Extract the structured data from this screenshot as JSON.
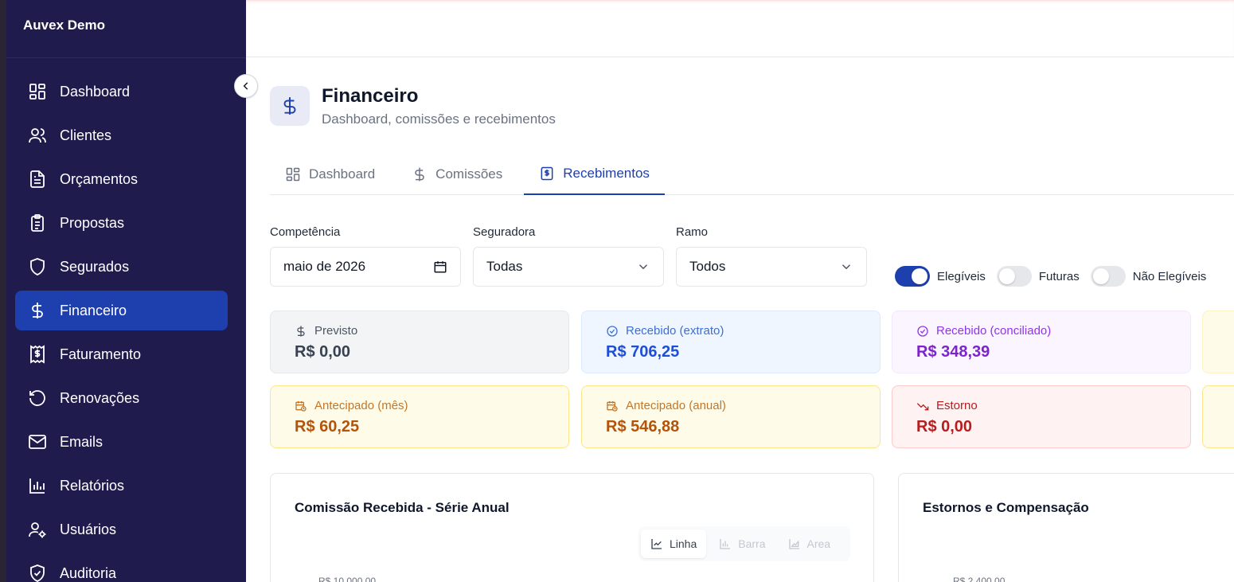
{
  "app": {
    "brand": "Auvex Demo"
  },
  "sidebar": {
    "items": [
      {
        "label": "Dashboard",
        "icon": "layout-grid-icon"
      },
      {
        "label": "Clientes",
        "icon": "users-icon"
      },
      {
        "label": "Orçamentos",
        "icon": "file-text-icon"
      },
      {
        "label": "Propostas",
        "icon": "clipboard-list-icon"
      },
      {
        "label": "Segurados",
        "icon": "shield-icon"
      },
      {
        "label": "Financeiro",
        "icon": "dollar-icon",
        "active": true
      },
      {
        "label": "Faturamento",
        "icon": "receipt-icon"
      },
      {
        "label": "Renovações",
        "icon": "rotate-ccw-icon"
      },
      {
        "label": "Emails",
        "icon": "mail-icon"
      },
      {
        "label": "Relatórios",
        "icon": "bar-chart-icon"
      },
      {
        "label": "Usuários",
        "icon": "user-cog-icon"
      },
      {
        "label": "Auditoria",
        "icon": "shield-check-icon"
      }
    ]
  },
  "page": {
    "title": "Financeiro",
    "subtitle": "Dashboard, comissões e recebimentos"
  },
  "tabs": [
    {
      "label": "Dashboard",
      "icon": "layout-grid-icon"
    },
    {
      "label": "Comissões",
      "icon": "dollar-icon"
    },
    {
      "label": "Recebimentos",
      "icon": "receipt-icon",
      "active": true
    }
  ],
  "filters": {
    "competencia": {
      "label": "Competência",
      "value": "maio de 2026"
    },
    "seguradora": {
      "label": "Seguradora",
      "value": "Todas"
    },
    "ramo": {
      "label": "Ramo",
      "value": "Todos"
    }
  },
  "toggles": [
    {
      "label": "Elegíveis",
      "on": true
    },
    {
      "label": "Futuras",
      "on": false
    },
    {
      "label": "Não Elegíveis",
      "on": false
    }
  ],
  "cards": {
    "previsto": {
      "label": "Previsto",
      "value": "R$ 0,00"
    },
    "recebido_extrato": {
      "label": "Recebido (extrato)",
      "value": "R$ 706,25"
    },
    "recebido_conciliado": {
      "label": "Recebido (conciliado)",
      "value": "R$ 348,39"
    },
    "antecipado_mes": {
      "label": "Antecipado (mês)",
      "value": "R$ 60,25"
    },
    "antecipado_anual": {
      "label": "Antecipado (anual)",
      "value": "R$ 546,88"
    },
    "estorno": {
      "label": "Estorno",
      "value": "R$ 0,00"
    }
  },
  "colors": {
    "sidebar_bg": "#1f1b4d",
    "accent": "#1e40af",
    "blue": "#1d4ed8",
    "purple": "#7e22ce",
    "amber": "#b45309",
    "red": "#b91c1c"
  },
  "panels": {
    "serie_anual": {
      "title": "Comissão Recebida - Série Anual",
      "chart_types": [
        "Linha",
        "Barra",
        "Area"
      ],
      "selected_type": "Linha",
      "y_top_label": "R$ 10.000,00"
    },
    "estornos": {
      "title": "Estornos e Compensação",
      "y_top_label": "R$ 2.400,00"
    }
  }
}
